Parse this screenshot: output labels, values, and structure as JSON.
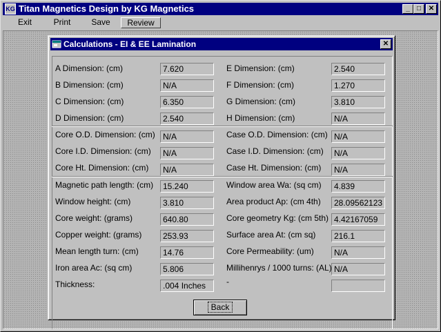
{
  "window": {
    "title": "Titan Magnetics Design by KG Magnetics",
    "icon_label": "KG",
    "minimize_glyph": "_",
    "maximize_glyph": "□",
    "close_glyph": "✕"
  },
  "menu": {
    "items": [
      {
        "label": "Exit"
      },
      {
        "label": "Print"
      },
      {
        "label": "Save"
      },
      {
        "label": "Review"
      }
    ]
  },
  "dialog": {
    "title": "Calculations - EI & EE Lamination",
    "icon": "window-icon",
    "close_glyph": "✕",
    "back_label": "Back",
    "left_fields": [
      {
        "label": "A Dimension: (cm)",
        "value": "7.620"
      },
      {
        "label": "B Dimension: (cm)",
        "value": "N/A"
      },
      {
        "label": "C Dimension: (cm)",
        "value": "6.350"
      },
      {
        "label": "D Dimension: (cm)",
        "value": "2.540"
      },
      {
        "label": "Core O.D. Dimension: (cm)",
        "value": "N/A"
      },
      {
        "label": "Core I.D. Dimension: (cm)",
        "value": "N/A"
      },
      {
        "label": "Core Ht. Dimension: (cm)",
        "value": "N/A"
      },
      {
        "label": "Magnetic path length: (cm)",
        "value": "15.240"
      },
      {
        "label": "Window height: (cm)",
        "value": "3.810"
      },
      {
        "label": "Core weight: (grams)",
        "value": "640.80"
      },
      {
        "label": "Copper weight: (grams)",
        "value": "253.93"
      },
      {
        "label": "Mean length turn: (cm)",
        "value": "14.76"
      },
      {
        "label": "Iron area Ac: (sq cm)",
        "value": "5.806"
      },
      {
        "label": "Thickness:",
        "value": ".004 Inches"
      }
    ],
    "right_fields": [
      {
        "label": "E Dimension: (cm)",
        "value": "2.540"
      },
      {
        "label": "F Dimension: (cm)",
        "value": "1.270"
      },
      {
        "label": "G Dimension: (cm)",
        "value": "3.810"
      },
      {
        "label": "H Dimension: (cm)",
        "value": "N/A"
      },
      {
        "label": "Case O.D. Dimension: (cm)",
        "value": "N/A"
      },
      {
        "label": "Case I.D. Dimension: (cm)",
        "value": "N/A"
      },
      {
        "label": "Case Ht. Dimension: (cm)",
        "value": "N/A"
      },
      {
        "label": "Window area Wa: (sq cm)",
        "value": "4.839"
      },
      {
        "label": "Area product Ap: (cm 4th)",
        "value": "28.09562123"
      },
      {
        "label": "Core geometry Kg: (cm 5th)",
        "value": "4.42167059"
      },
      {
        "label": "Surface area At: (cm sq)",
        "value": "216.1"
      },
      {
        "label": "Core Permeability: (um)",
        "value": "N/A"
      },
      {
        "label": "Millihenrys / 1000 turns: (AL)",
        "value": "N/A"
      },
      {
        "label": "-",
        "value": ""
      }
    ]
  }
}
